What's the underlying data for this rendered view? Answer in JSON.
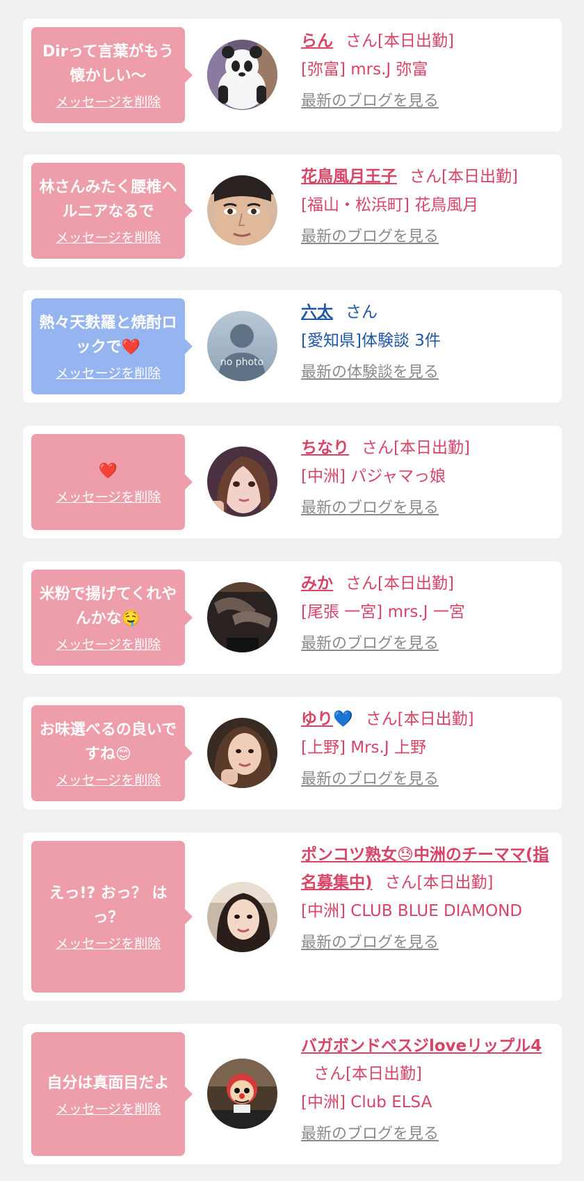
{
  "delete_label": "メッセージを削除",
  "colors": {
    "background": "#f0f0f2",
    "card": "#ffffff",
    "bubble_pink": "#ee9eaa",
    "bubble_blue": "#96b5f0",
    "name_pink": "#d84466",
    "name_blue": "#1f56a8",
    "link_gray": "#8a8a8a"
  },
  "items": [
    {
      "message": "Dirって言葉がもう懐かしい〜",
      "name": "らん",
      "suffix": "さん[本日出勤]",
      "shop": "[弥富] mrs.J 弥富",
      "link": "最新のブログを見る",
      "avatar_icon": "panda-costume-photo"
    },
    {
      "message": "林さんみたく腰椎ヘルニアなるで",
      "name": "花鳥風月王子",
      "suffix": "さん[本日出勤]",
      "shop": "[福山・松浜町] 花鳥風月",
      "link": "最新のブログを見る",
      "avatar_icon": "face-closeup-photo"
    },
    {
      "message": "熱々天麩羅と焼酎ロックで",
      "message_emoji": "❤️",
      "name": "六太",
      "suffix": "さん",
      "shop": "[愛知県]体験談 3件",
      "link": "最新の体験談を見る",
      "avatar_icon": "no-photo-placeholder",
      "avatar_text": "no photo"
    },
    {
      "message_emoji": "❤️",
      "name": "ちなり",
      "suffix": "さん[本日出勤]",
      "shop": "[中洲] パジャマっ娘",
      "link": "最新のブログを見る",
      "avatar_icon": "girl-selfie-photo"
    },
    {
      "message": "米粉で揚げてくれやんかな",
      "message_emoji": "🤤",
      "name": "みか",
      "suffix": "さん[本日出勤]",
      "shop": "[尾張 一宮] mrs.J 一宮",
      "link": "最新のブログを見る",
      "avatar_icon": "legs-stockings-photo"
    },
    {
      "message": "お味選べるの良いですね",
      "message_emoji": "😊",
      "name": "ゆり",
      "name_emoji": "💙",
      "suffix": "さん[本日出勤]",
      "shop": "[上野] Mrs.J 上野",
      "link": "最新のブログを見る",
      "avatar_icon": "woman-portrait-photo"
    },
    {
      "message": "えっ!? おっ？ はっ？",
      "name": "ポンコツ熟女😓中洲のチーママ(指名募集中)",
      "suffix": "さん[本日出勤]",
      "shop": "[中洲] CLUB BLUE DIAMOND",
      "link": "最新のブログを見る",
      "avatar_icon": "woman-portrait-photo"
    },
    {
      "message": "自分は真面目だよ",
      "name": "バガボンドペスジloveリップル4",
      "suffix": "さん[本日出勤]",
      "shop": "[中洲] Club ELSA",
      "link": "最新のブログを見る",
      "avatar_icon": "mask-character-photo"
    }
  ]
}
